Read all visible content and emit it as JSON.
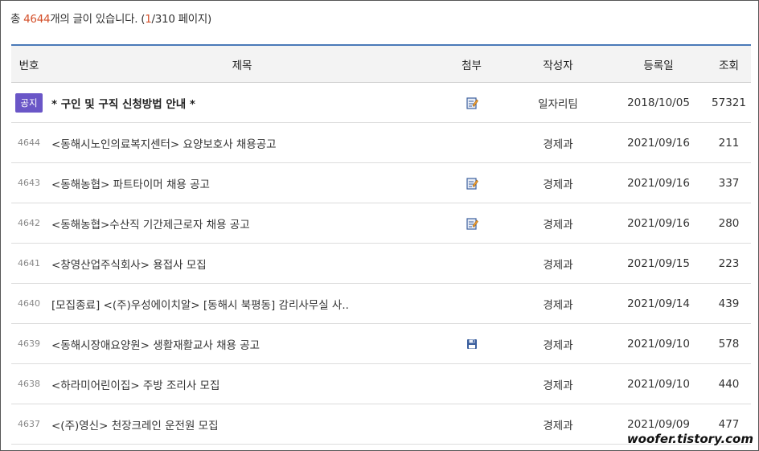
{
  "summary": {
    "prefix": "총 ",
    "total": "4644",
    "mid": "개의 글이 있습니다. (",
    "page": "1",
    "suffix": "/310 페이지)"
  },
  "headers": {
    "num": "번호",
    "title": "제목",
    "attach": "첨부",
    "author": "작성자",
    "date": "등록일",
    "views": "조회"
  },
  "notice": {
    "badge": "공지",
    "title": "* 구인 및 구직 신청방법 안내 *",
    "author": "일자리팀",
    "date": "2018/10/05",
    "views": "57321"
  },
  "rows": [
    {
      "num": "4644",
      "title": "<동해시노인의료복지센터> 요양보호사 채용공고",
      "author": "경제과",
      "date": "2021/09/16",
      "views": "211"
    },
    {
      "num": "4643",
      "title": "<동해농협> 파트타이머 채용 공고",
      "author": "경제과",
      "date": "2021/09/16",
      "views": "337"
    },
    {
      "num": "4642",
      "title": "<동해농협>수산직 기간제근로자 채용 공고",
      "author": "경제과",
      "date": "2021/09/16",
      "views": "280"
    },
    {
      "num": "4641",
      "title": "<창영산업주식회사> 용접사 모집",
      "author": "경제과",
      "date": "2021/09/15",
      "views": "223"
    },
    {
      "num": "4640",
      "title": "[모집종료] <(주)우성에이치알> [동해시 북평동] 감리사무실 사..",
      "author": "경제과",
      "date": "2021/09/14",
      "views": "439"
    },
    {
      "num": "4639",
      "title": "<동해시장애요양원> 생활재활교사 채용 공고",
      "author": "경제과",
      "date": "2021/09/10",
      "views": "578"
    },
    {
      "num": "4638",
      "title": "<하라미어린이집> 주방 조리사 모집",
      "author": "경제과",
      "date": "2021/09/10",
      "views": "440"
    },
    {
      "num": "4637",
      "title": "<(주)영신> 천장크레인 운전원 모집",
      "author": "경제과",
      "date": "2021/09/09",
      "views": "477"
    }
  ],
  "icons": {
    "doc_attach": "document-edit-icon",
    "disk_attach": "floppy-disk-icon"
  },
  "colors": {
    "accent_border": "#4a79b8",
    "count_highlight": "#d4502a",
    "badge_bg": "#6a56c7"
  },
  "watermark": "woofer.tistory.com"
}
